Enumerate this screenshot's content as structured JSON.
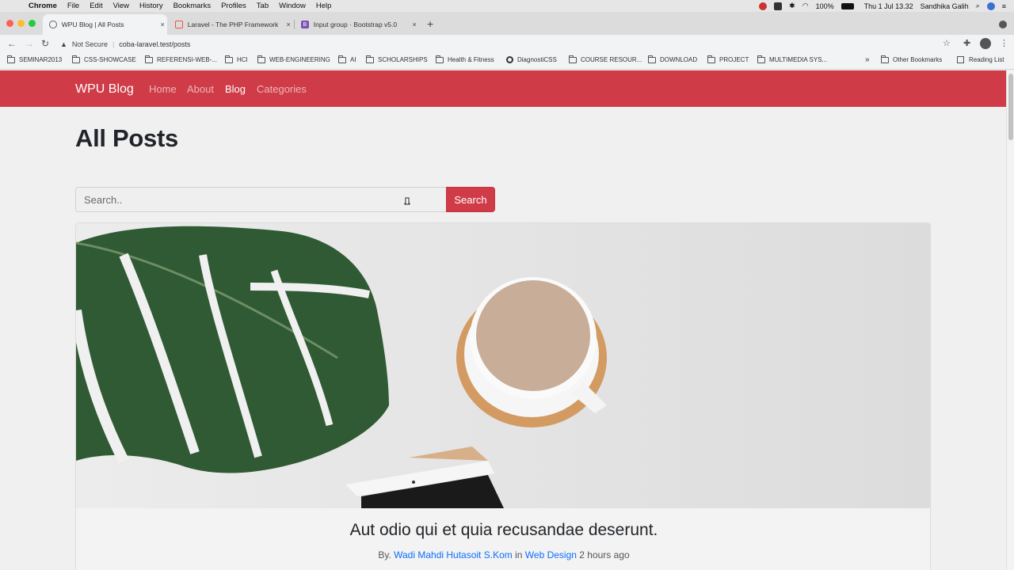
{
  "menubar": {
    "app": "Chrome",
    "items": [
      "File",
      "Edit",
      "View",
      "History",
      "Bookmarks",
      "Profiles",
      "Tab",
      "Window",
      "Help"
    ],
    "battery": "100%",
    "datetime": "Thu 1 Jul  13.32",
    "user": "Sandhika Galih"
  },
  "tabs": [
    {
      "title": "WPU Blog | All Posts",
      "close": "×"
    },
    {
      "title": "Laravel - The PHP Framework",
      "close": "×"
    },
    {
      "title": "Input group · Bootstrap v5.0",
      "close": "×"
    }
  ],
  "tab_favicon_b": "B",
  "new_tab": "+",
  "toolbar": {
    "security_label": "Not Secure",
    "url": "coba-laravel.test/posts"
  },
  "bookmarks": {
    "items": [
      "SEMINAR2013",
      "CSS-SHOWCASE",
      "REFERENSI-WEB-...",
      "HCI",
      "WEB-ENGINEERING",
      "AI",
      "SCHOLARSHIPS",
      "Health & Fitness",
      "DiagnostiCSS",
      "COURSE RESOUR...",
      "DOWNLOAD",
      "PROJECT",
      "MULTIMEDIA SYS..."
    ],
    "more": "»",
    "other": "Other Bookmarks",
    "reading_list": "Reading List"
  },
  "site": {
    "brand": "WPU Blog",
    "nav": [
      {
        "label": "Home",
        "active": false
      },
      {
        "label": "About",
        "active": false
      },
      {
        "label": "Blog",
        "active": true
      },
      {
        "label": "Categories",
        "active": false
      }
    ],
    "accent_color": "#cf3b47"
  },
  "main": {
    "title": "All Posts",
    "search": {
      "placeholder": "Search..",
      "button_label": "Search"
    },
    "post": {
      "title": "Aut odio qui et quia recusandae deserunt.",
      "by_label": "By.",
      "author": "Wadi Mahdi Hutasoit S.Kom",
      "in_label": "in",
      "category": "Web Design",
      "time": "2 hours ago"
    }
  }
}
